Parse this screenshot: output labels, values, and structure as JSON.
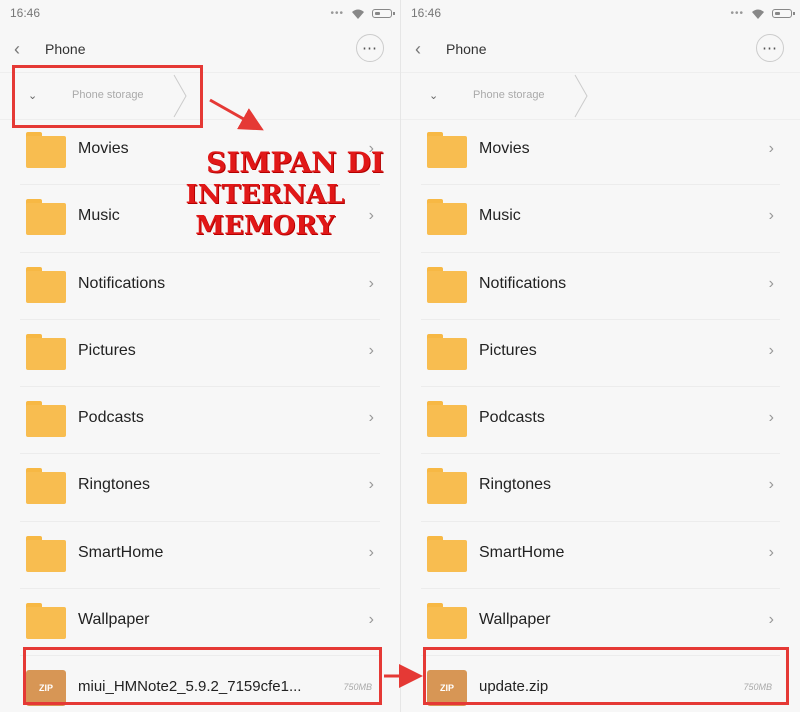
{
  "left": {
    "time": "16:46",
    "title": "Phone",
    "more_icon": "⋯",
    "breadcrumb": "Phone storage",
    "items": [
      {
        "name": "Movies"
      },
      {
        "name": "Music"
      },
      {
        "name": "Notifications"
      },
      {
        "name": "Pictures"
      },
      {
        "name": "Podcasts"
      },
      {
        "name": "Ringtones"
      },
      {
        "name": "SmartHome"
      },
      {
        "name": "Wallpaper"
      }
    ],
    "file": {
      "badge": "ZIP",
      "name": "miui_HMNote2_5.9.2_7159cfe1...",
      "size": "750MB"
    }
  },
  "right": {
    "time": "16:46",
    "title": "Phone",
    "more_icon": "⋯",
    "breadcrumb": "Phone storage",
    "items": [
      {
        "name": "Movies"
      },
      {
        "name": "Music"
      },
      {
        "name": "Notifications"
      },
      {
        "name": "Pictures"
      },
      {
        "name": "Podcasts"
      },
      {
        "name": "Ringtones"
      },
      {
        "name": "SmartHome"
      },
      {
        "name": "Wallpaper"
      }
    ],
    "file": {
      "badge": "ZIP",
      "name": "update.zip",
      "size": "750MB"
    }
  },
  "annotation": {
    "line1": "SIMPAN DI",
    "line2": "INTERNAL MEMORY"
  },
  "colors": {
    "folder": "#f8bd50",
    "zip": "#d79655",
    "highlight": "#e53935"
  }
}
